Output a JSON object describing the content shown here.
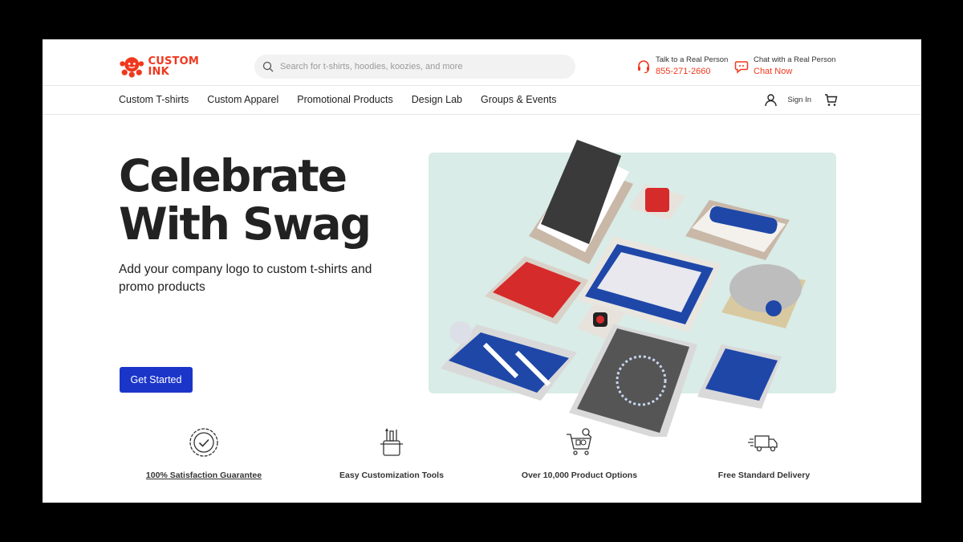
{
  "header": {
    "logo": {
      "line1": "CUSTOM",
      "line2": "INK"
    },
    "search": {
      "placeholder": "Search for t-shirts, hoodies, koozies, and more",
      "value": ""
    },
    "phone": {
      "label": "Talk to a Real Person",
      "value": "855-271-2660"
    },
    "chat": {
      "label": "Chat with a Real Person",
      "value": "Chat Now"
    }
  },
  "nav": {
    "items": [
      "Custom T-shirts",
      "Custom Apparel",
      "Promotional Products",
      "Design Lab",
      "Groups & Events"
    ],
    "signin": "Sign In"
  },
  "hero": {
    "title_line1": "Celebrate",
    "title_line2": "With Swag",
    "subtitle": "Add your company logo to custom t-shirts and promo products",
    "cta": "Get Started"
  },
  "features": [
    {
      "icon": "badge-check-icon",
      "label": "100% Satisfaction Guarantee"
    },
    {
      "icon": "design-tools-icon",
      "label": "Easy Customization Tools"
    },
    {
      "icon": "shopping-cart-icon",
      "label": "Over 10,000 Product Options"
    },
    {
      "icon": "delivery-truck-icon",
      "label": "Free Standard Delivery"
    }
  ],
  "colors": {
    "brand": "#f0381e",
    "cta": "#1b35c9",
    "hero_bg": "#d9ece7"
  }
}
